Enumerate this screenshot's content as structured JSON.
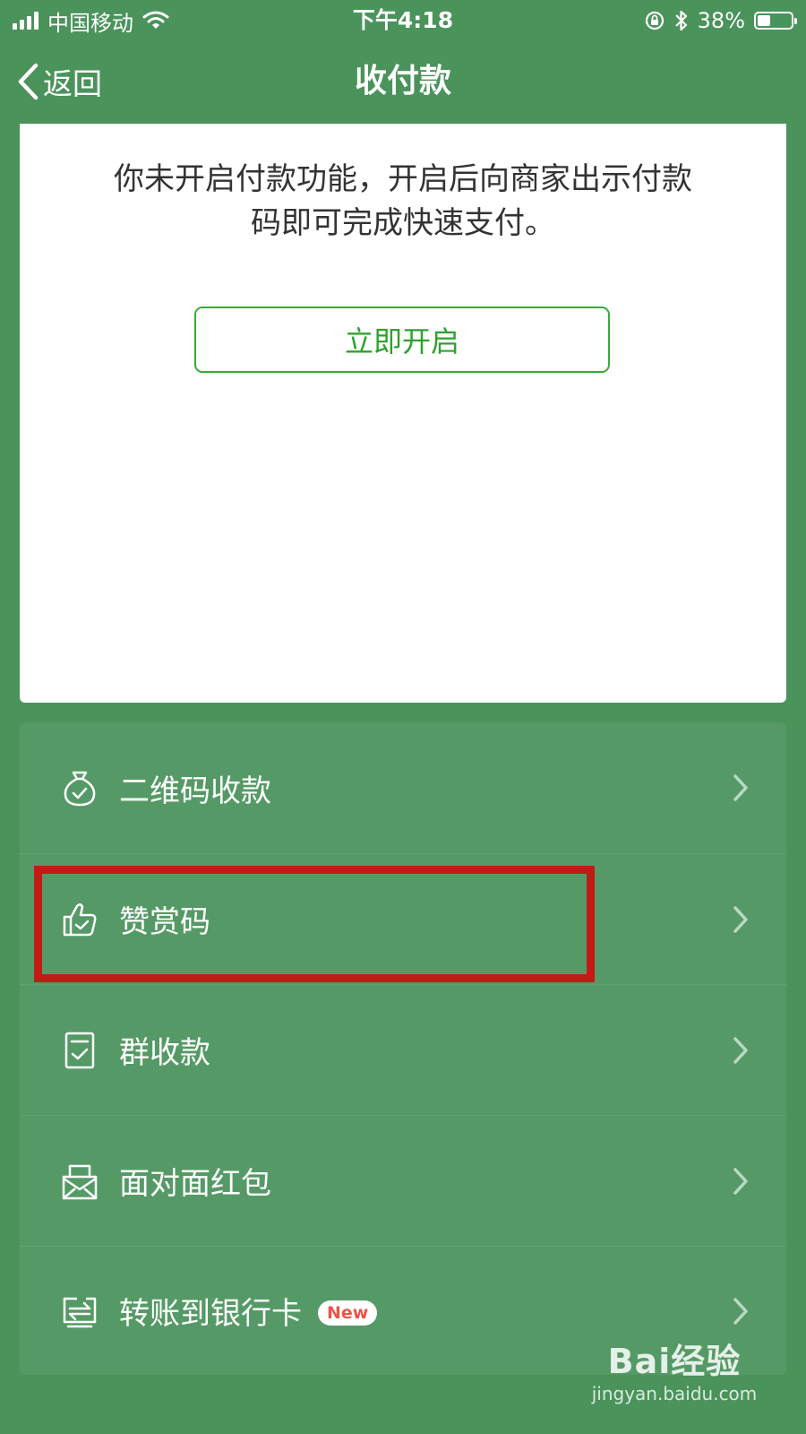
{
  "status_bar": {
    "carrier": "中国移动",
    "time": "下午4:18",
    "battery_percent_label": "38%",
    "battery_level": 0.38
  },
  "nav": {
    "back_label": "返回",
    "title": "收付款"
  },
  "pay_card": {
    "description": "你未开启付款功能，开启后向商家出示付款码即可完成快速支付。",
    "open_button_label": "立即开启"
  },
  "menu": {
    "items": [
      {
        "label": "二维码收款",
        "icon": "money-bag-icon"
      },
      {
        "label": "赞赏码",
        "icon": "thumbs-up-icon"
      },
      {
        "label": "群收款",
        "icon": "receipt-check-icon"
      },
      {
        "label": "面对面红包",
        "icon": "red-packet-icon"
      },
      {
        "label": "转账到银行卡",
        "icon": "bank-card-transfer-icon",
        "badge": "New"
      }
    ]
  },
  "watermark": {
    "logo": "Bai经验",
    "url": "jingyan.baidu.com"
  },
  "colors": {
    "background": "#4a935b",
    "menu_background": "#559a66",
    "button_green": "#2fa12f",
    "highlight_red": "#c21a14",
    "badge_red": "#e8564b"
  }
}
